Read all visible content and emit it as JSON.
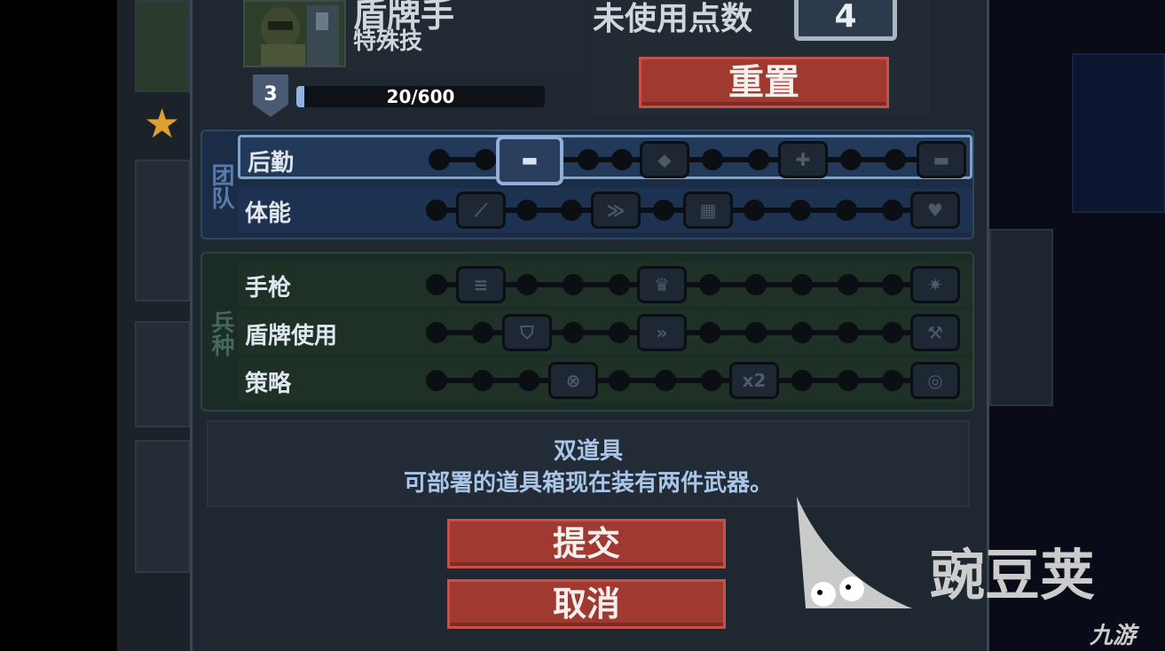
{
  "unit": {
    "name": "盾牌手",
    "subtitle": "特殊技",
    "level": "3",
    "xp": "20/600",
    "xp_fraction": 0.033
  },
  "points": {
    "label": "未使用点数",
    "value": "4"
  },
  "buttons": {
    "reset": "重置",
    "submit": "提交",
    "cancel": "取消"
  },
  "groups": {
    "team": {
      "label": "团队"
    },
    "arms": {
      "label": "兵种"
    }
  },
  "skills": {
    "logistics": "后勤",
    "stamina": "体能",
    "pistol": "手枪",
    "shield_use": "盾牌使用",
    "tactics": "策略"
  },
  "nodes": {
    "tactics_x2": "x2"
  },
  "description": {
    "title": "双道具",
    "text": "可部署的道具箱现在装有两件武器。"
  },
  "watermark": {
    "brand": "豌豆荚",
    "site": "九游"
  },
  "colors": {
    "button_red": "#a03a30",
    "team_blue": "#1a2c46",
    "arms_green": "#1b2b26"
  }
}
